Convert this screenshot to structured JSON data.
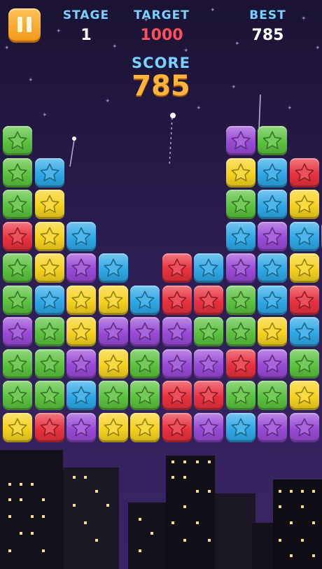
{
  "hud": {
    "stage_label": "STAGE",
    "stage_value": "1",
    "target_label": "TARGET",
    "target_value": "1000",
    "best_label": "BEST",
    "best_value": "785",
    "score_label": "SCORE",
    "score_value": "785"
  },
  "colors": {
    "G": "#5bc23e",
    "B": "#2ea8e6",
    "Y": "#f5d21f",
    "R": "#e8313e",
    "P": "#9a4ad6",
    "stage_value": "#ffffff",
    "target_value": "#ff4f5a",
    "best_value": "#ffffff"
  },
  "board": [
    "G......PG",
    "GB.....YBR",
    "GY.....GBY",
    "RYB....BPBB",
    "GYPB.RBPBY",
    "GBYYBRRGBR",
    "PGYPPPGGYB",
    "GGPYGPPRPG",
    "GGBGGRRGGY",
    "YRPYYRPBPP"
  ],
  "icons": {
    "pause": "pause-icon",
    "tile": "star-icon"
  }
}
